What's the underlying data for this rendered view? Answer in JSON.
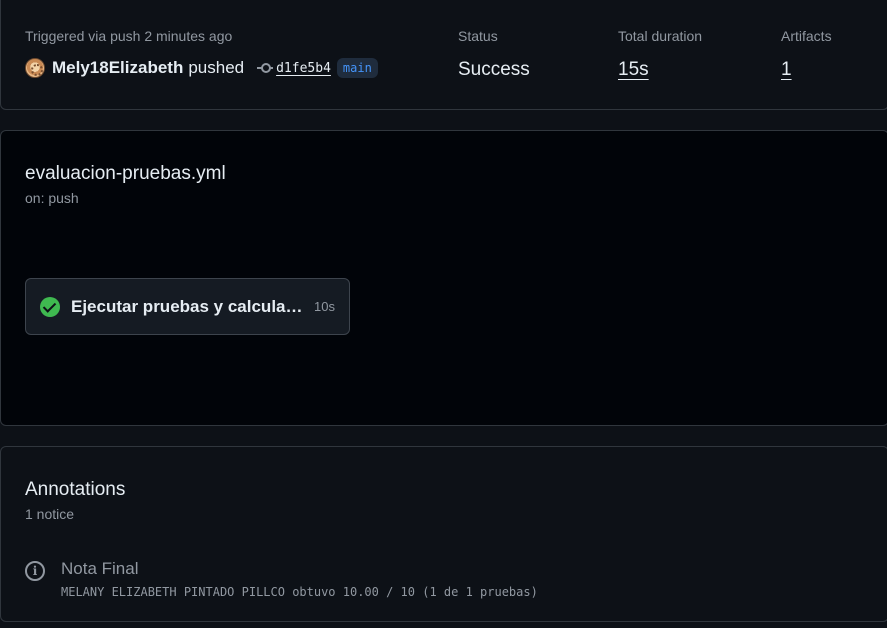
{
  "summary": {
    "trigger_text": "Triggered via push 2 minutes ago",
    "actor": "Mely18Elizabeth",
    "action": "pushed",
    "commit_sha": "d1fe5b4",
    "branch": "main",
    "status_label": "Status",
    "status_value": "Success",
    "duration_label": "Total duration",
    "duration_value": "15s",
    "artifacts_label": "Artifacts",
    "artifacts_value": "1"
  },
  "workflow": {
    "file": "evaluacion-pruebas.yml",
    "trigger": "on: push",
    "job": {
      "name": "Ejecutar pruebas y calcular nota",
      "duration": "10s",
      "status_icon": "check-circle-icon",
      "status_color": "#3fb950"
    }
  },
  "annotations": {
    "title": "Annotations",
    "count": "1 notice",
    "items": [
      {
        "icon": "info-icon",
        "title": "Nota Final",
        "message": "MELANY ELIZABETH PINTADO PILLCO obtuvo 10.00 / 10 (1 de 1 pruebas)"
      }
    ]
  },
  "colors": {
    "background": "#0d1117",
    "graph_background": "#010409",
    "link": "#4493f8",
    "success": "#3fb950"
  }
}
